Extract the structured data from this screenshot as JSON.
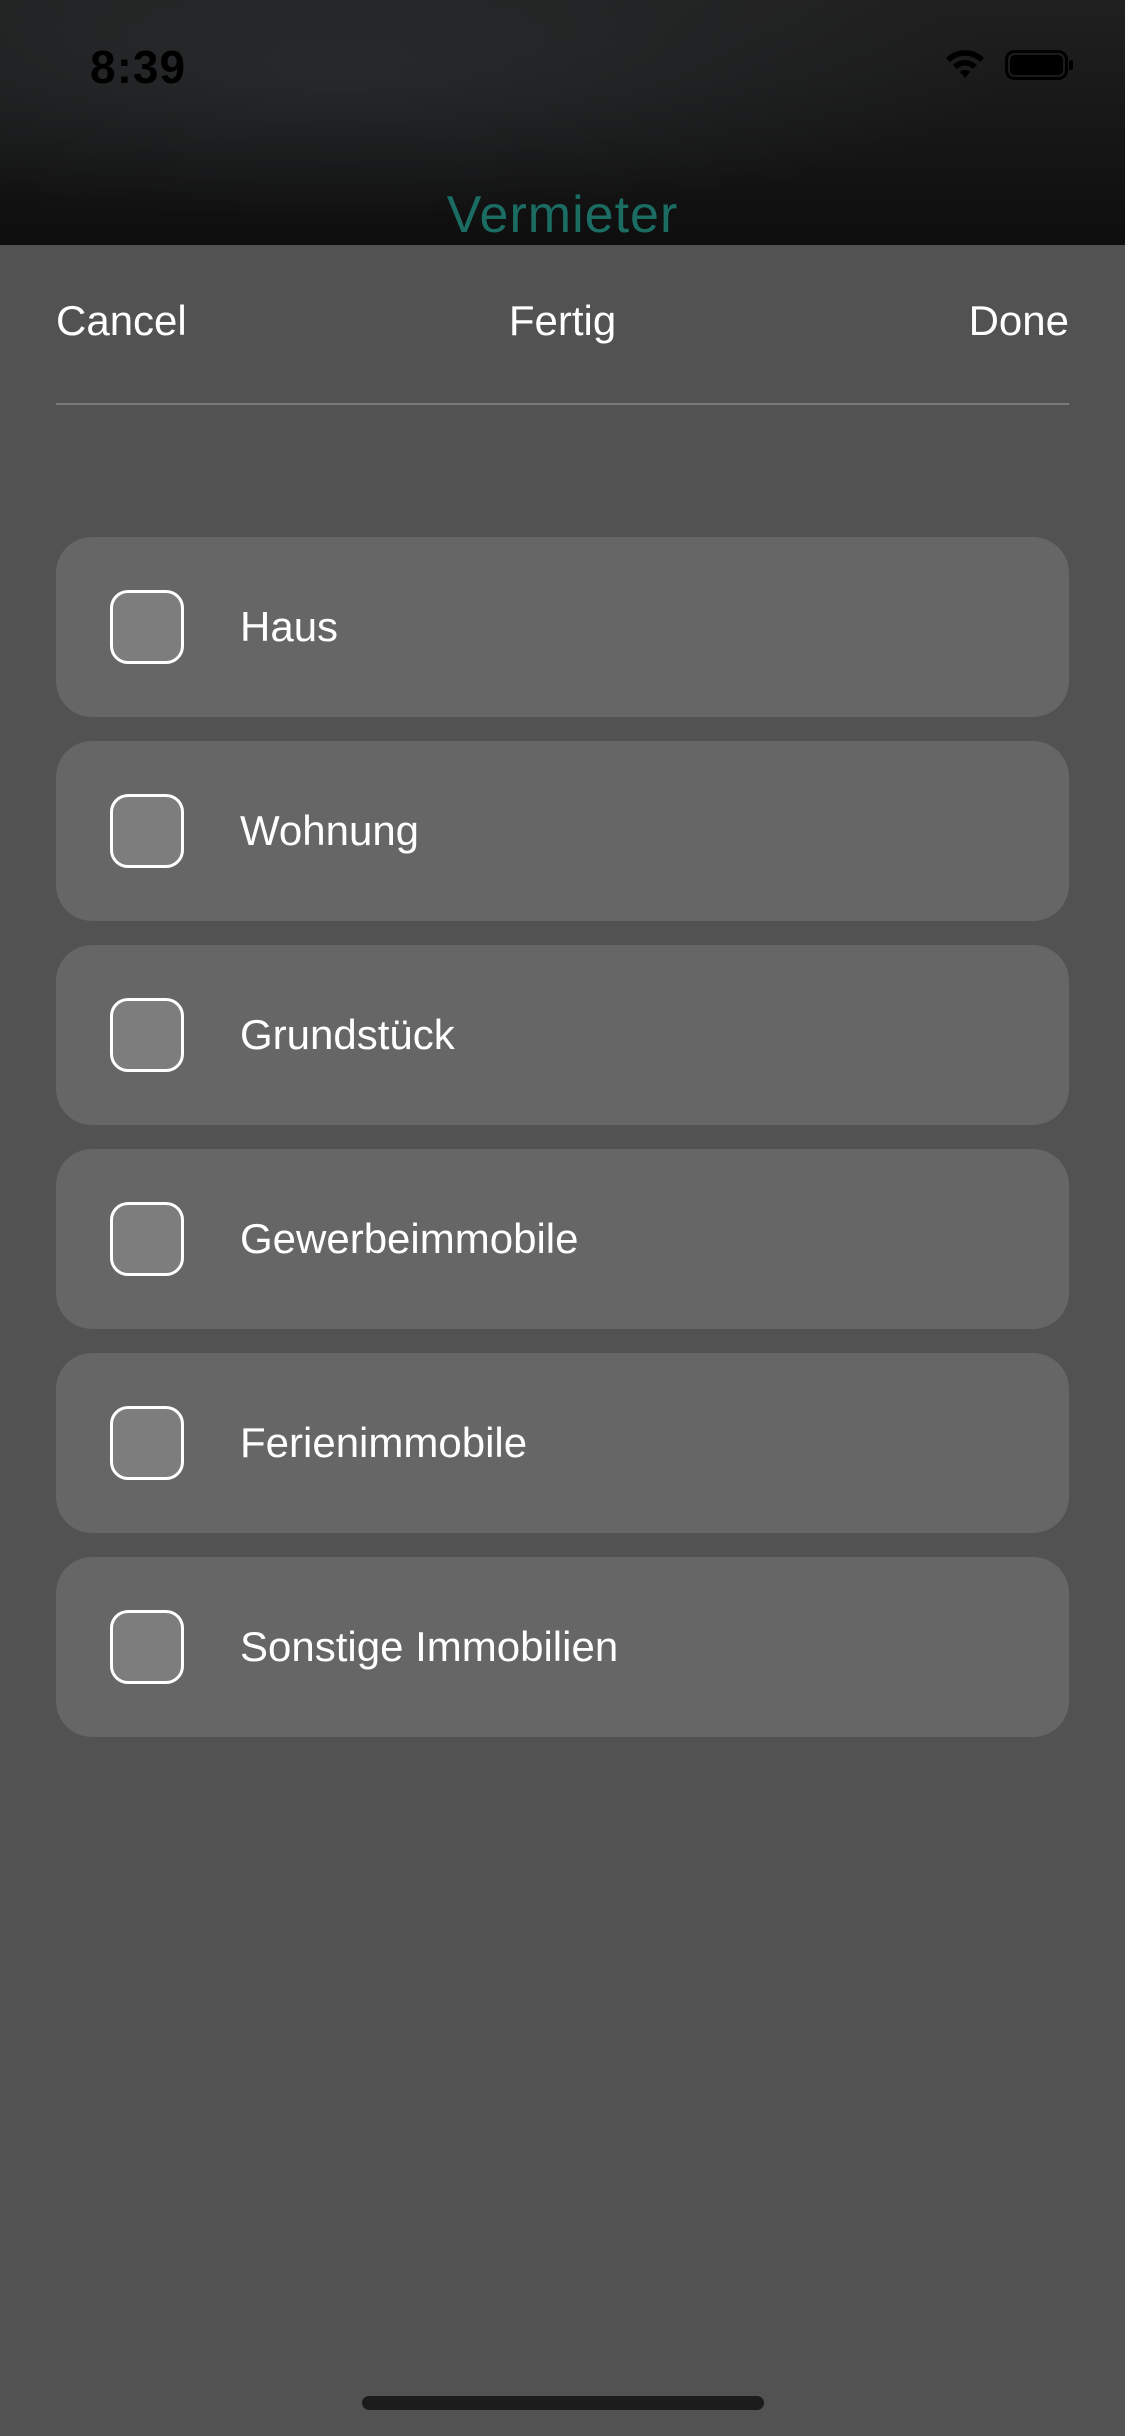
{
  "status_bar": {
    "time": "8:39",
    "icons": [
      "wifi-icon",
      "battery-icon"
    ]
  },
  "background_screen": {
    "title": "Vermieter",
    "title_color": "#1b6d63"
  },
  "sheet": {
    "cancel_label": "Cancel",
    "title": "Fertig",
    "done_label": "Done",
    "options": [
      {
        "label": "Haus",
        "checked": false
      },
      {
        "label": "Wohnung",
        "checked": false
      },
      {
        "label": "Grundstück",
        "checked": false
      },
      {
        "label": "Gewerbeimmobile",
        "checked": false
      },
      {
        "label": "Ferienimmobile",
        "checked": false
      },
      {
        "label": "Sonstige Immobilien",
        "checked": false
      }
    ]
  },
  "colors": {
    "sheet_background": "#525252",
    "option_background": "#666666",
    "checkbox_fill": "#7d7d7d"
  }
}
